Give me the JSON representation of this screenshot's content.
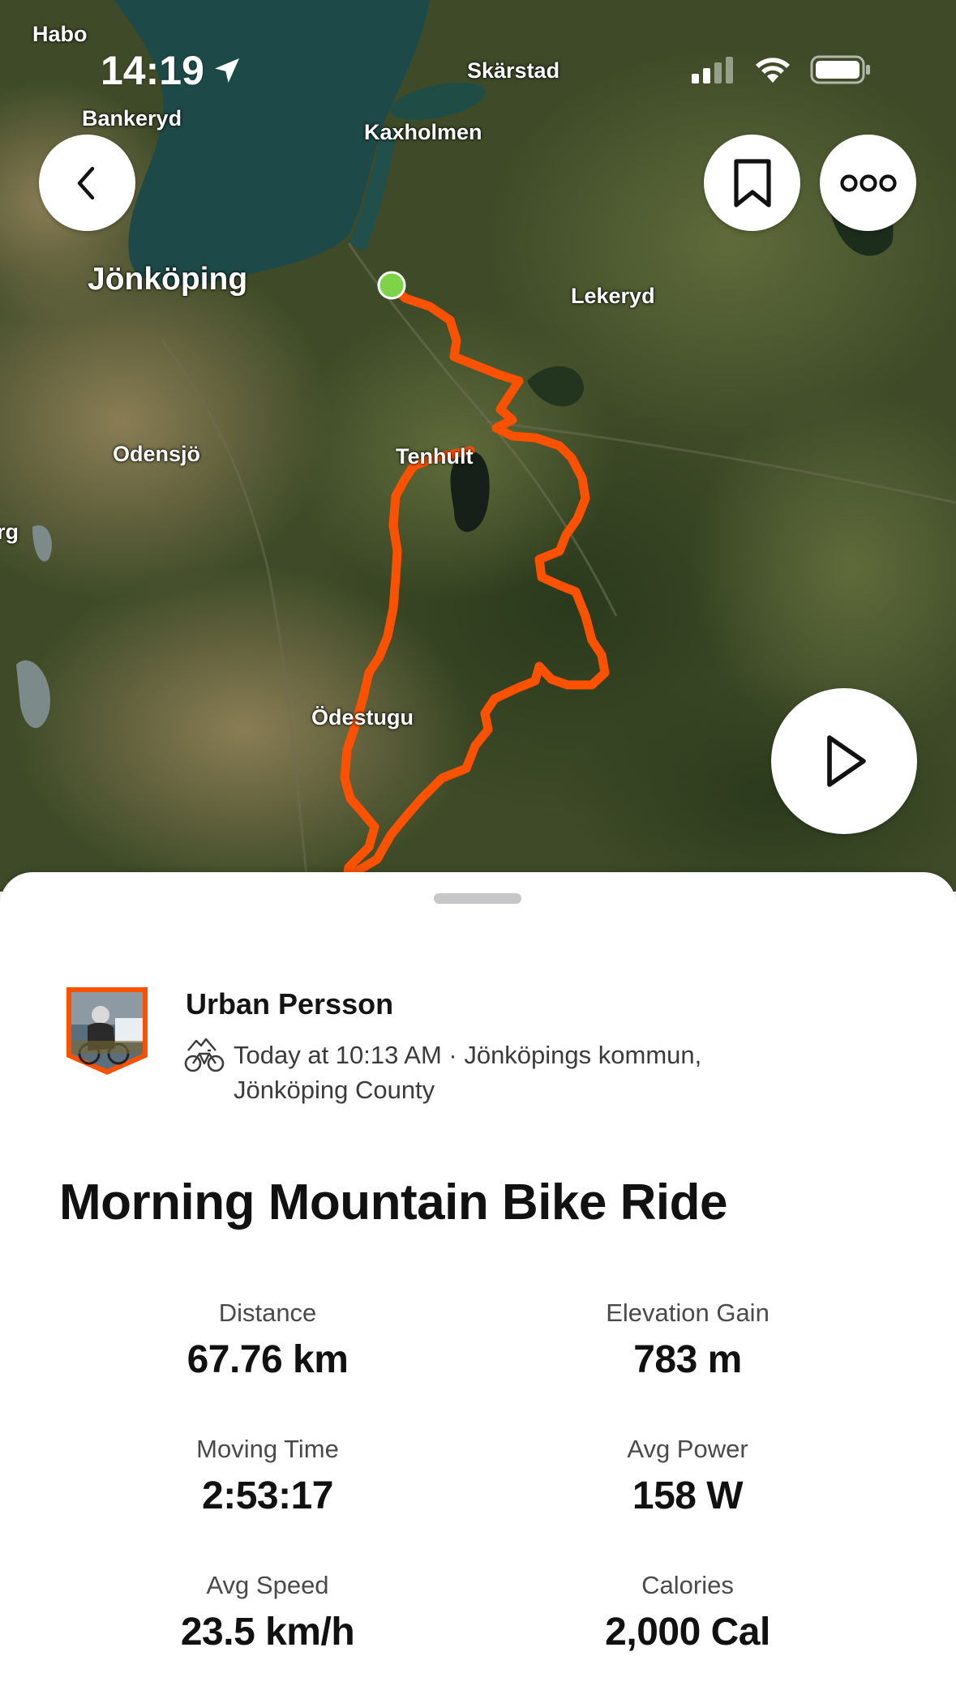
{
  "status_bar": {
    "time": "14:19"
  },
  "map": {
    "places": {
      "habo": "Habo",
      "skarstad": "Skärstad",
      "bankeryd": "Bankeryd",
      "kaxholmen": "Kaxholmen",
      "jonkoping": "Jönköping",
      "lekeryd": "Lekeryd",
      "odensjo": "Odensjö",
      "tenhult": "Tenhult",
      "rg": "rg",
      "odestugu": "Ödestugu"
    },
    "route_color": "#fc5200",
    "start_marker_color": "#7ed348"
  },
  "buttons": {
    "back_icon": "chevron-left-icon",
    "bookmark_icon": "bookmark-icon",
    "more_icon": "more-dots-icon",
    "play_icon": "play-icon"
  },
  "activity": {
    "athlete_name": "Urban Persson",
    "sport_icon": "mountain-bike-icon",
    "meta_line1": "Today at 10:13 AM · Jönköpings kommun,",
    "meta_line2": "Jönköping County",
    "title": "Morning Mountain Bike Ride"
  },
  "stats": [
    {
      "label": "Distance",
      "value": "67.76 km"
    },
    {
      "label": "Elevation Gain",
      "value": "783 m"
    },
    {
      "label": "Moving Time",
      "value": "2:53:17"
    },
    {
      "label": "Avg Power",
      "value": "158 W"
    },
    {
      "label": "Avg Speed",
      "value": "23.5 km/h"
    },
    {
      "label": "Calories",
      "value": "2,000 Cal"
    }
  ]
}
